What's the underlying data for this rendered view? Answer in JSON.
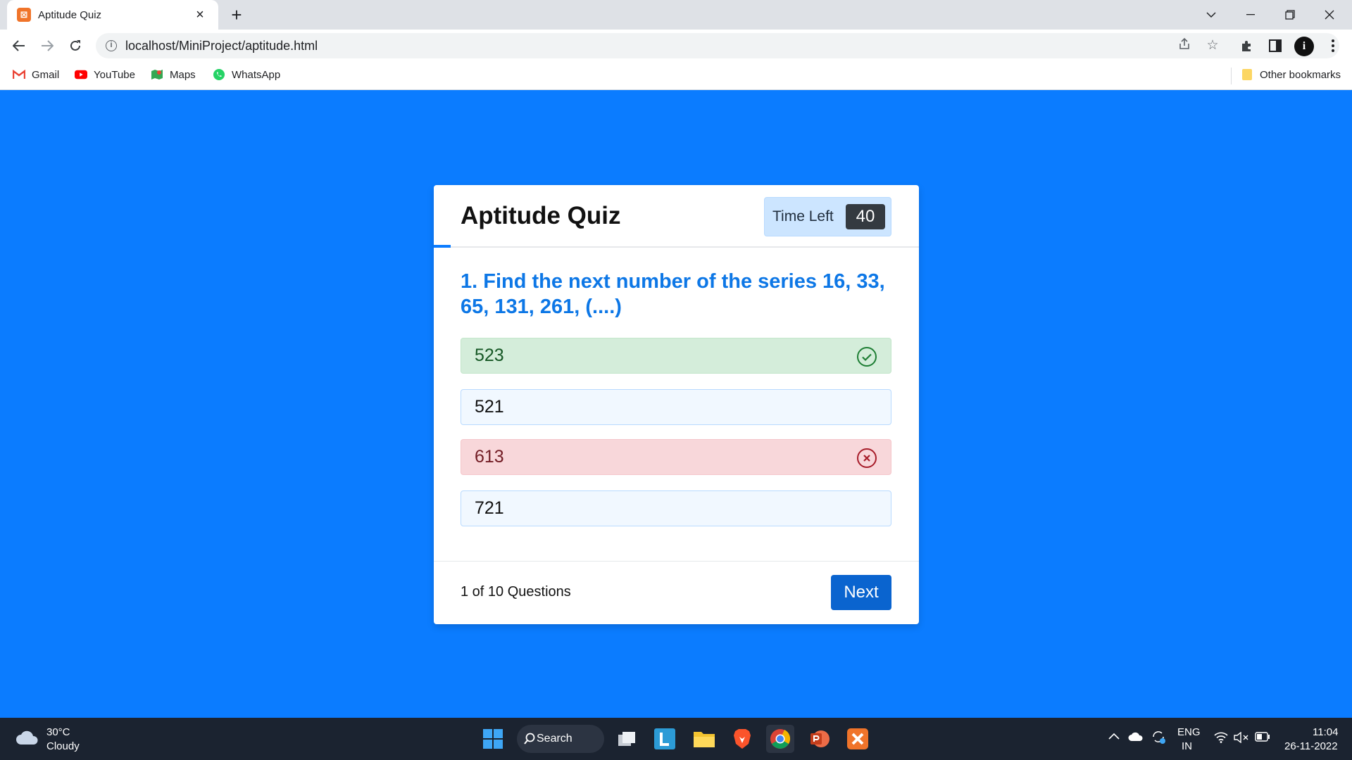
{
  "browser": {
    "tab_title": "Aptitude Quiz",
    "tab_favicon": "⊠",
    "url": "localhost/MiniProject/aptitude.html",
    "profile_initial": "i",
    "bookmarks": [
      {
        "label": "Gmail",
        "icon": "gmail-icon"
      },
      {
        "label": "YouTube",
        "icon": "youtube-icon"
      },
      {
        "label": "Maps",
        "icon": "maps-icon"
      },
      {
        "label": "WhatsApp",
        "icon": "whatsapp-icon"
      }
    ],
    "other_bookmarks": "Other bookmarks"
  },
  "quiz": {
    "title": "Aptitude Quiz",
    "timer_label": "Time Left",
    "timer_value": "40",
    "question": "1. Find the next number of the series 16, 33, 65, 131, 261, (....)",
    "options": [
      {
        "text": "523",
        "state": "correct"
      },
      {
        "text": "521",
        "state": "default"
      },
      {
        "text": "613",
        "state": "wrong"
      },
      {
        "text": "721",
        "state": "default"
      }
    ],
    "counter": "1 of 10 Questions",
    "next_label": "Next"
  },
  "colors": {
    "page_background": "#0b7cff",
    "question_text": "#0d77e6",
    "correct_bg": "#d4edda",
    "wrong_bg": "#f8d7da",
    "next_button": "#0a64cf"
  },
  "taskbar": {
    "weather_temp": "30°C",
    "weather_condition": "Cloudy",
    "search_label": "Search",
    "lang_top": "ENG",
    "lang_bottom": "IN",
    "time": "11:04",
    "date": "26-11-2022"
  }
}
